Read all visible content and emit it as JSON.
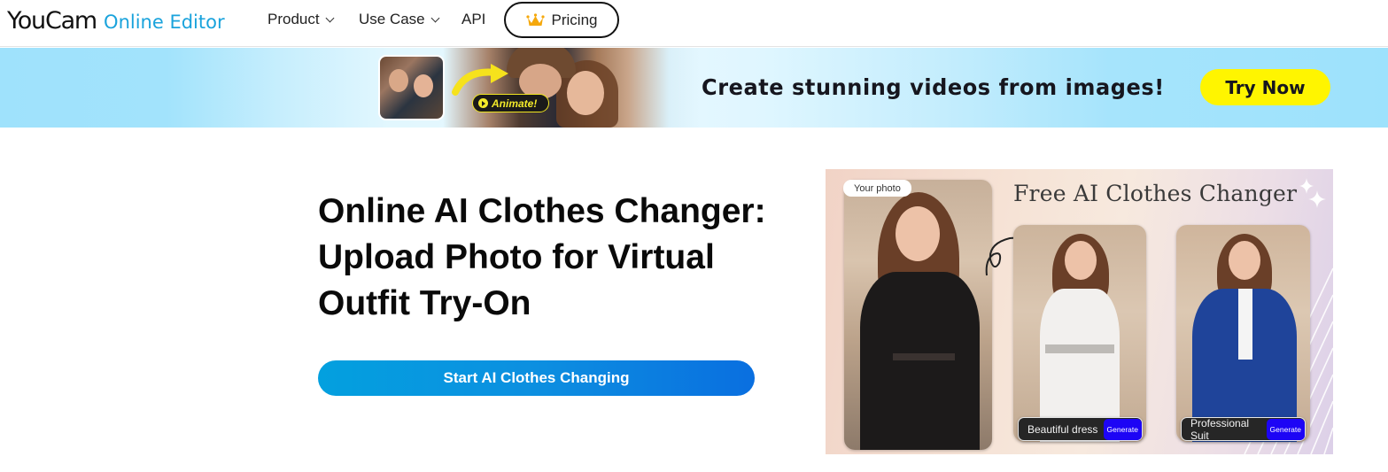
{
  "nav": {
    "logo_main": "YouCam",
    "logo_sub": "Online Editor",
    "items": [
      {
        "label": "Product",
        "has_dropdown": true
      },
      {
        "label": "Use Case",
        "has_dropdown": true
      },
      {
        "label": "API",
        "has_dropdown": false
      }
    ],
    "pricing_label": "Pricing",
    "pricing_icon": "crown-icon"
  },
  "banner": {
    "animate_label": "Animate!",
    "headline": "Create stunning videos from images!",
    "cta_label": "Try Now",
    "cta_color": "#fff500"
  },
  "hero": {
    "title_lines": [
      "Online AI Clothes Changer:",
      "Upload Photo for Virtual",
      "Outfit Try-On"
    ],
    "cta_label": "Start AI Clothes Changing",
    "cta_gradient": [
      "#03a0df",
      "#0a6fe0"
    ]
  },
  "hero_image": {
    "title": "Free AI Clothes Changer",
    "source_label": "Your photo",
    "outfits": [
      {
        "label": "Beautiful dress",
        "button": "Generate"
      },
      {
        "label": "Professional Suit",
        "button": "Generate"
      }
    ],
    "generate_color": "#1d05f5"
  }
}
